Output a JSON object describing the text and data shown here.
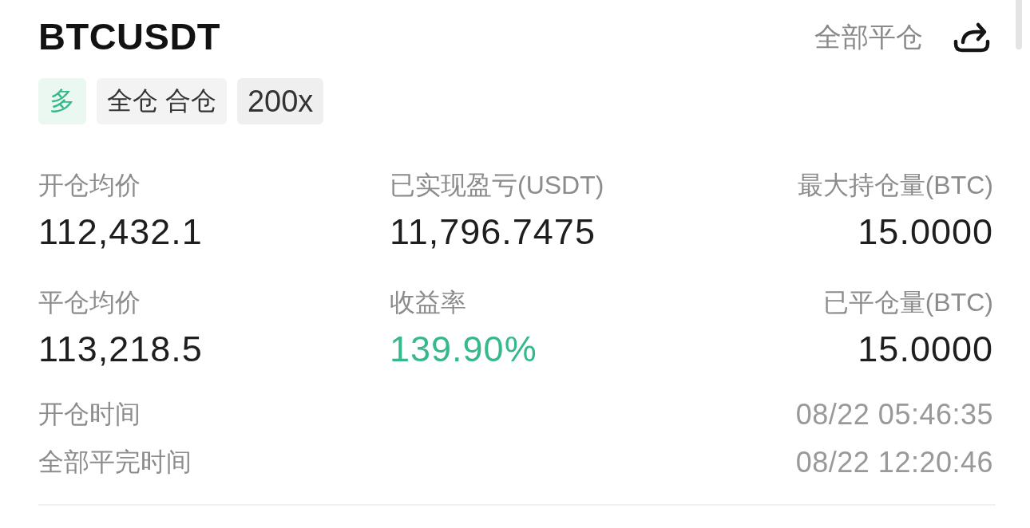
{
  "header": {
    "symbol": "BTCUSDT",
    "close_all_button": "全部平仓"
  },
  "tags": [
    {
      "kind": "side",
      "label": "多"
    },
    {
      "kind": "mode",
      "label": "全仓 合仓"
    },
    {
      "kind": "leverage",
      "label": "200x"
    }
  ],
  "stats": [
    [
      {
        "kind": "plain",
        "label": "开仓均价",
        "value": "112,432.1"
      },
      {
        "kind": "plain",
        "label": "已实现盈亏(USDT)",
        "value": "11,796.7475"
      },
      {
        "kind": "plain",
        "label": "最大持仓量(BTC)",
        "value": "15.0000"
      }
    ],
    [
      {
        "kind": "plain",
        "label": "平仓均价",
        "value": "113,218.5"
      },
      {
        "kind": "gain",
        "label": "收益率",
        "value": "139.90%"
      },
      {
        "kind": "plain",
        "label": "已平仓量(BTC)",
        "value": "15.0000"
      }
    ]
  ],
  "times": [
    {
      "label": "开仓时间",
      "value": "08/22 05:46:35"
    },
    {
      "label": "全部平完时间",
      "value": "08/22 12:20:46"
    }
  ]
}
